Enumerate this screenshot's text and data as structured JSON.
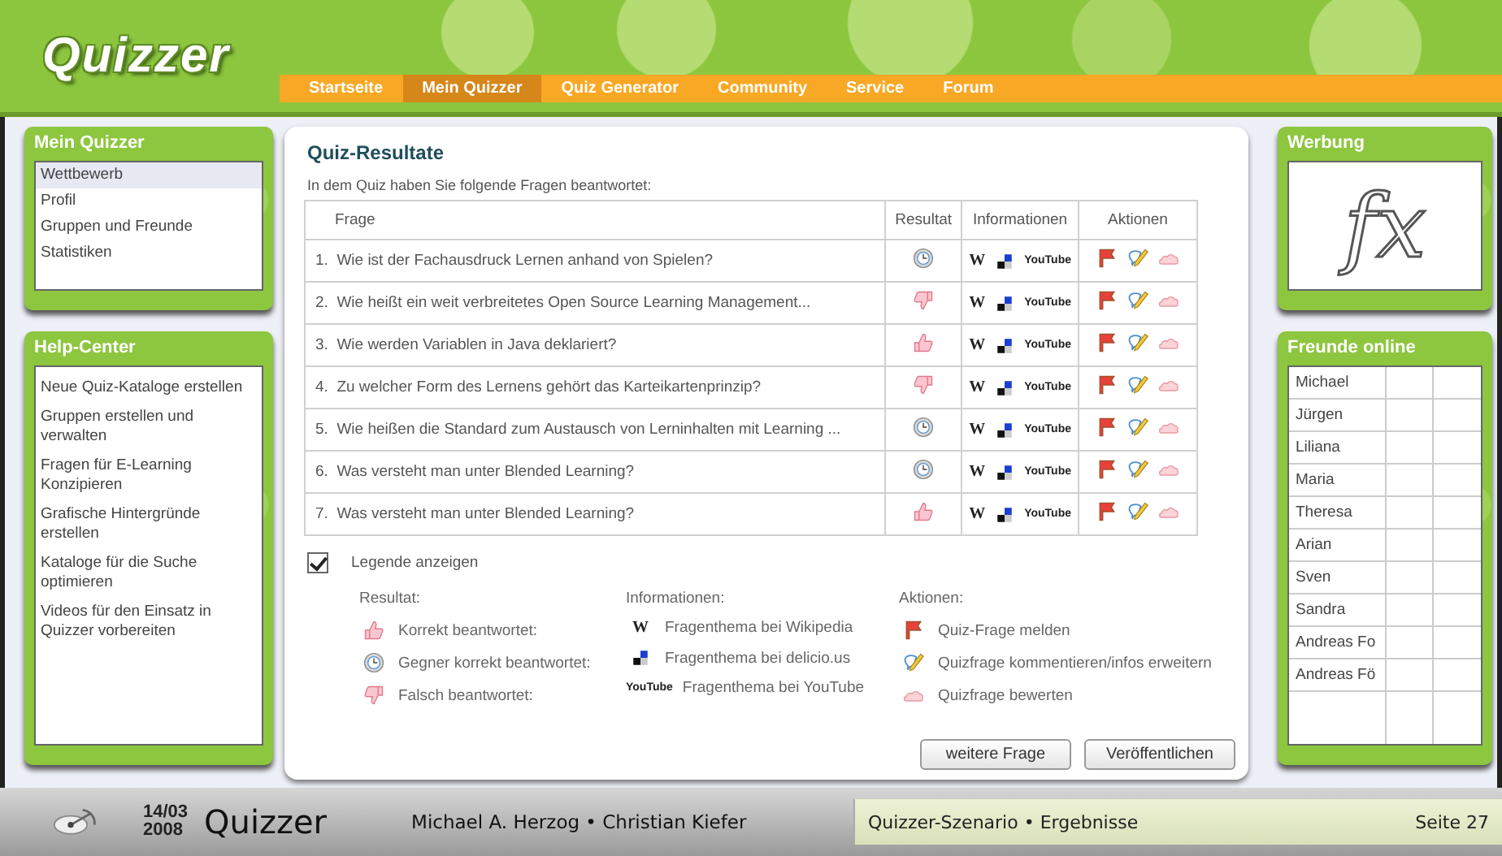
{
  "logo": "Quizzer",
  "nav": [
    {
      "label": "Startseite",
      "selected": false
    },
    {
      "label": "Mein Quizzer",
      "selected": true
    },
    {
      "label": "Quiz Generator",
      "selected": false
    },
    {
      "label": "Community",
      "selected": false
    },
    {
      "label": "Service",
      "selected": false
    },
    {
      "label": "Forum",
      "selected": false
    }
  ],
  "mein_quizzer": {
    "title": "Mein Quizzer",
    "items": [
      {
        "label": "Wettbewerb",
        "selected": true
      },
      {
        "label": "Profil",
        "selected": false
      },
      {
        "label": "Gruppen und Freunde",
        "selected": false
      },
      {
        "label": "Statistiken",
        "selected": false
      }
    ]
  },
  "help_center": {
    "title": "Help-Center",
    "items": [
      "Neue Quiz-Kataloge erstellen",
      "Gruppen erstellen und verwalten",
      "Fragen für E-Learning Konzipieren",
      "Grafische Hintergründe erstellen",
      "Kataloge für die Suche optimieren",
      "Videos für den Einsatz in Quizzer vorbereiten"
    ]
  },
  "main": {
    "title": "Quiz-Resultate",
    "intro": "In dem Quiz haben Sie folgende Fragen beantwortet:",
    "columns": [
      "Frage",
      "Resultat",
      "Informationen",
      "Aktionen"
    ],
    "rows": [
      {
        "number": "1.",
        "question": "Wie ist der Fachausdruck Lernen anhand von Spielen?",
        "result": {
          "kind": "opponent"
        },
        "wiki": "W",
        "youtube": [
          "You",
          "Tube"
        ]
      },
      {
        "number": "2.",
        "question": "Wie heißt ein weit verbreitetes Open Source Learning Management...",
        "result": {
          "kind": "wrong"
        },
        "wiki": "W",
        "youtube": [
          "You",
          "Tube"
        ]
      },
      {
        "number": "3.",
        "question": "Wie werden Variablen in Java deklariert?",
        "result": {
          "kind": "correct"
        },
        "wiki": "W",
        "youtube": [
          "You",
          "Tube"
        ]
      },
      {
        "number": "4.",
        "question": "Zu welcher Form des Lernens gehört das Karteikartenprinzip?",
        "result": {
          "kind": "wrong"
        },
        "wiki": "W",
        "youtube": [
          "You",
          "Tube"
        ]
      },
      {
        "number": "5.",
        "question": "Wie heißen die  Standard zum Austausch von Lerninhalten mit Learning ...",
        "result": {
          "kind": "opponent"
        },
        "wiki": "W",
        "youtube": [
          "You",
          "Tube"
        ]
      },
      {
        "number": "6.",
        "question": "Was versteht man unter Blended Learning?",
        "result": {
          "kind": "opponent"
        },
        "wiki": "W",
        "youtube": [
          "You",
          "Tube"
        ]
      },
      {
        "number": "7.",
        "question": "Was versteht man unter Blended Learning?",
        "result": {
          "kind": "correct"
        },
        "wiki": "W",
        "youtube": [
          "You",
          "Tube"
        ]
      }
    ],
    "legend_toggle": {
      "label": "Legende anzeigen",
      "checked": true
    },
    "legend": [
      {
        "heading": "Resultat:",
        "items": [
          {
            "kind": "correct",
            "label": "Korrekt beantwortet:"
          },
          {
            "kind": "opponent",
            "label": "Gegner korrekt beantwortet:"
          },
          {
            "kind": "wrong",
            "label": "Falsch beantwortet:"
          }
        ]
      },
      {
        "heading": "Informationen:",
        "items": [
          {
            "kind": "wikipedia",
            "logo": [
              "W"
            ],
            "label": "Fragenthema bei Wikipedia"
          },
          {
            "kind": "delicious",
            "label": "Fragenthema bei delicio.us"
          },
          {
            "kind": "youtube",
            "logo": [
              "You",
              "Tube"
            ],
            "label": "Fragenthema bei YouTube"
          }
        ]
      },
      {
        "heading": "Aktionen:",
        "items": [
          {
            "kind": "report",
            "label": "Quiz-Frage melden"
          },
          {
            "kind": "comment",
            "label": "Quizfrage kommentieren/infos erweitern"
          },
          {
            "kind": "rate",
            "label": "Quizfrage bewerten"
          }
        ]
      }
    ],
    "buttons": [
      "weitere Frage",
      "Veröffentlichen"
    ]
  },
  "ad": {
    "title": "Werbung",
    "text": "fx"
  },
  "friends": {
    "title": "Freunde online",
    "names": [
      "Michael",
      "Jürgen",
      "Liliana",
      "Maria",
      "Theresa",
      "Arian",
      "Sven",
      "Sandra",
      "Andreas Fo",
      "Andreas Fö"
    ]
  },
  "footer": {
    "day": "14/03",
    "year": "2008",
    "brand": "Quizzer",
    "authors": "Michael A. Herzog • Christian Kiefer",
    "topic": "Quizzer-Szenario • Ergebnisse",
    "page": "Seite 27"
  }
}
